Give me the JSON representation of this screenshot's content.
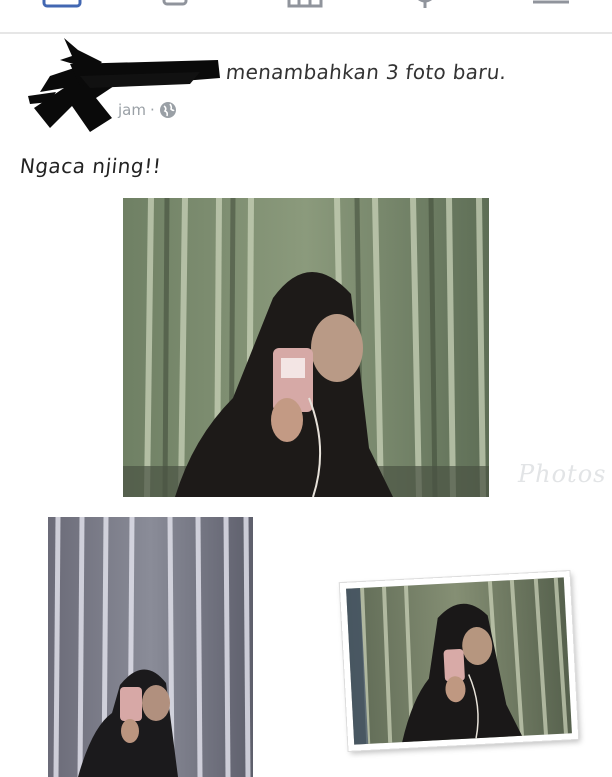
{
  "top_nav": {
    "icons": [
      "home-icon",
      "friends-icon",
      "marketplace-icon",
      "notifications-icon",
      "menu-icon"
    ],
    "accent_color": "#4267B2"
  },
  "post": {
    "actor_action": "menambahkan 3 foto baru.",
    "timestamp": "jam",
    "separator": "·",
    "privacy_icon": "globe-icon",
    "caption": "Ngaca njing!!",
    "photo_count": 3,
    "watermark": "Photos"
  }
}
